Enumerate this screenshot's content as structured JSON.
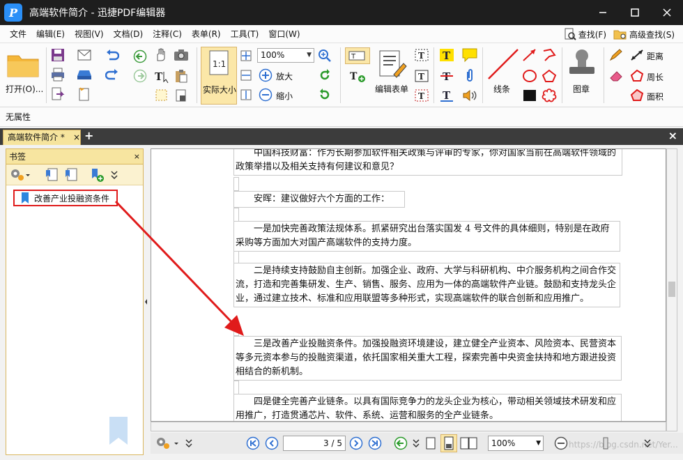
{
  "window": {
    "title": "高端软件简介 - 迅捷PDF编辑器"
  },
  "menu": {
    "items": [
      "文件",
      "编辑(E)",
      "视图(V)",
      "文档(D)",
      "注释(C)",
      "表单(R)",
      "工具(T)",
      "窗口(W)"
    ],
    "find": "查找(F)",
    "advanced_find": "高级查找(S)"
  },
  "toolbar": {
    "open": "打开(O)...",
    "actual_size": "实际大小",
    "zoom_value": "100%",
    "zoom_in": "放大",
    "zoom_out": "缩小",
    "edit_form": "编辑表单",
    "line": "线条",
    "stamp": "图章",
    "distance": "距离",
    "perimeter": "周长",
    "area": "面积"
  },
  "properties": {
    "label": "无属性"
  },
  "tabs": {
    "active": "高端软件简介 *",
    "close": "×",
    "add": "+"
  },
  "bookmarks": {
    "title": "书签",
    "items": [
      {
        "label": "改善产业投融资条件"
      }
    ]
  },
  "document": {
    "paragraphs": [
      "中国科技财富：作为长期参加软件相关政策与评审的专家，你对国家当前在高端软件领域的政策举措以及相关支持有何建议和意见？",
      "安晖：建议做好六个方面的工作：",
      "一是加快完善政策法规体系。抓紧研究出台落实国发 4 号文件的具体细则，特别是在政府采购等方面加大对国产高端软件的支持力度。",
      "二是持续支持鼓励自主创新。加强企业、政府、大学与科研机构、中介服务机构之间合作交流，打造和完善集研发、生产、销售、服务、应用为一体的高端软件产业链。鼓励和支持龙头企业，通过建立技术、标准和应用联盟等多种形式，实现高端软件的联合创新和应用推广。",
      "三是改善产业投融资条件。加强投融资环境建设，建立健全产业资本、风险资本、民营资本等多元资本参与的投融资渠道，依托国家相关重大工程，探索完善中央资金扶持和地方跟进投资相结合的新机制。",
      "四是健全完善产业链条。以具有国际竞争力的龙头企业为核心，带动相关领域技术研发和应用推广，打造贯通芯片、软件、系统、运营和服务的全产业链条。"
    ]
  },
  "status": {
    "page": "3",
    "page_total": "5",
    "zoom": "100%",
    "watermark": "https://blog.csdn.net/Yer..."
  },
  "colors": {
    "accent_red": "#e01b1b",
    "tab_yellow": "#f6e49d"
  }
}
